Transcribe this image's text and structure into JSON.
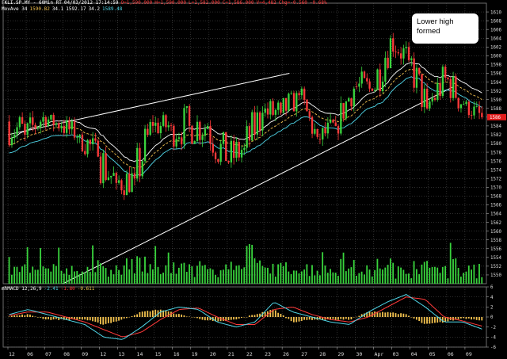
{
  "header": {
    "line1": [
      {
        "text": "FKLI.SP.MY - 60Min RT",
        "color": "#ffffff"
      },
      {
        "text": "04/03/2012 17:14:59",
        "color": "#ffffff"
      },
      {
        "text": "O=1,590.000",
        "color": "#ff3a3a"
      },
      {
        "text": "H=1,590.000",
        "color": "#ff3a3a"
      },
      {
        "text": "L=1,582.000",
        "color": "#ff3a3a"
      },
      {
        "text": "C=1,586.000",
        "color": "#ff3a3a"
      },
      {
        "text": "V=4,482",
        "color": "#ff3a3a"
      },
      {
        "text": "Chg=-0.560",
        "color": "#ff3a3a"
      },
      {
        "text": "-0.68%",
        "color": "#ff3a3a"
      }
    ],
    "line2": [
      {
        "text": "MovAve 34",
        "color": "#ffffff"
      },
      {
        "text": "1590.82",
        "color": "#f2c14e"
      },
      {
        "text": "34.1",
        "color": "#ffffff"
      },
      {
        "text": "1592.17",
        "color": "#ffffff"
      },
      {
        "text": "34.2",
        "color": "#ffffff"
      },
      {
        "text": "1589.48",
        "color": "#4fd6e8"
      }
    ],
    "macd": [
      {
        "text": "mhMACD 12,26,9",
        "color": "#ffffff"
      },
      {
        "text": "-2.41",
        "color": "#4fd6e8"
      },
      {
        "text": "-1.80",
        "color": "#ff3a3a"
      },
      {
        "text": "-0.611",
        "color": "#f2c14e"
      }
    ]
  },
  "annotation": {
    "line1": "Lower high",
    "line2": "formed"
  },
  "chart_data": [
    {
      "type": "candlestick",
      "title": "",
      "ylim": [
        1548,
        1612
      ],
      "y_ticks": [
        1550,
        1552,
        1554,
        1556,
        1558,
        1560,
        1562,
        1564,
        1566,
        1568,
        1570,
        1572,
        1574,
        1576,
        1578,
        1580,
        1582,
        1584,
        1586,
        1588,
        1590,
        1592,
        1594,
        1596,
        1598,
        1600,
        1602,
        1604,
        1606,
        1608,
        1610
      ],
      "last_price": 1586,
      "x_tick_labels": [
        "12",
        "06",
        "07",
        "08",
        "09",
        "12",
        "13",
        "14",
        "15",
        "16",
        "19",
        "20",
        "21",
        "22",
        "23",
        "26",
        "27",
        "28",
        "29",
        "30",
        "Apr",
        "03",
        "04",
        "05",
        "06",
        "09"
      ],
      "day_series": {
        "open": [
          1585,
          1582,
          1586,
          1584,
          1582,
          1577,
          1571,
          1572,
          1584,
          1584,
          1584,
          1584,
          1576,
          1579,
          1587,
          1587,
          1591,
          1581,
          1584,
          1593,
          1592,
          1604,
          1599,
          1588,
          1595,
          1589
        ],
        "high": [
          1597,
          1590,
          1587,
          1589,
          1586,
          1580,
          1578,
          1588,
          1590,
          1589,
          1590,
          1590,
          1588,
          1596,
          1596,
          1592,
          1593,
          1588,
          1593,
          1599,
          1607,
          1607,
          1603,
          1598,
          1599,
          1590
        ],
        "low": [
          1579,
          1578,
          1580,
          1580,
          1573,
          1561,
          1565,
          1567,
          1580,
          1571,
          1574,
          1570,
          1572,
          1578,
          1583,
          1580,
          1581,
          1578,
          1580,
          1584,
          1588,
          1594,
          1586,
          1582,
          1585,
          1582
        ],
        "close": [
          1582,
          1586,
          1584,
          1582,
          1577,
          1571,
          1572,
          1584,
          1584,
          1584,
          1584,
          1576,
          1579,
          1587,
          1587,
          1591,
          1581,
          1584,
          1593,
          1592,
          1604,
          1599,
          1588,
          1595,
          1589,
          1586
        ]
      },
      "moving_averages": [
        {
          "label": "MovAve 34",
          "color": "#f2c14e",
          "style": "dashed"
        },
        {
          "label": "34.1",
          "color": "#ffffff",
          "style": "solid"
        },
        {
          "label": "34.2",
          "color": "#4fd6e8",
          "style": "solid"
        }
      ],
      "trendlines": [
        {
          "from": [
            "12",
            1582
          ],
          "to": [
            "27",
            1596
          ]
        },
        {
          "from": [
            "08",
            1548
          ],
          "to": [
            "09",
            1593
          ]
        }
      ],
      "volume": {
        "color": "#39d43d"
      },
      "line_colors": {
        "up": "#39d43d",
        "down": "#ff3a3a",
        "grid": "#5a5a5a"
      }
    },
    {
      "type": "macd",
      "ylim": [
        -6,
        6
      ],
      "y_ticks": [
        -6,
        -4,
        -2,
        0,
        2,
        4,
        6
      ],
      "x_tick_labels": [
        "12",
        "06",
        "07",
        "08",
        "09",
        "12",
        "13",
        "14",
        "15",
        "16",
        "19",
        "20",
        "21",
        "22",
        "23",
        "26",
        "27",
        "28",
        "29",
        "30",
        "Apr",
        "03",
        "04",
        "05",
        "06",
        "09"
      ],
      "macd_line": [
        0.5,
        1.5,
        0.5,
        -0.5,
        -1.5,
        -4.0,
        -4.5,
        -2.0,
        1.0,
        2.0,
        1.5,
        -1.0,
        -2.0,
        -1.0,
        3.0,
        1.0,
        0.0,
        -1.0,
        -1.5,
        1.0,
        3.0,
        4.5,
        2.0,
        -1.0,
        -1.0,
        -2.41
      ],
      "signal_line": [
        0.3,
        1.0,
        1.0,
        0.0,
        -1.0,
        -2.5,
        -4.0,
        -3.0,
        -0.5,
        1.5,
        1.8,
        0.0,
        -1.5,
        -1.5,
        1.5,
        2.0,
        0.5,
        -0.5,
        -1.0,
        0.0,
        2.0,
        4.0,
        3.5,
        0.0,
        -0.8,
        -1.8
      ],
      "histogram": [
        0.2,
        0.5,
        -0.5,
        -0.5,
        -0.5,
        -1.5,
        -0.5,
        1.0,
        1.5,
        0.5,
        -0.3,
        -1.0,
        -0.5,
        0.5,
        1.5,
        -1.0,
        -0.5,
        -0.5,
        -0.5,
        1.0,
        1.0,
        0.5,
        -1.5,
        -1.0,
        -0.2,
        -0.611
      ],
      "colors": {
        "macd": "#4fd6e8",
        "signal": "#ff3a3a",
        "histogram": "#f2c14e"
      }
    }
  ]
}
